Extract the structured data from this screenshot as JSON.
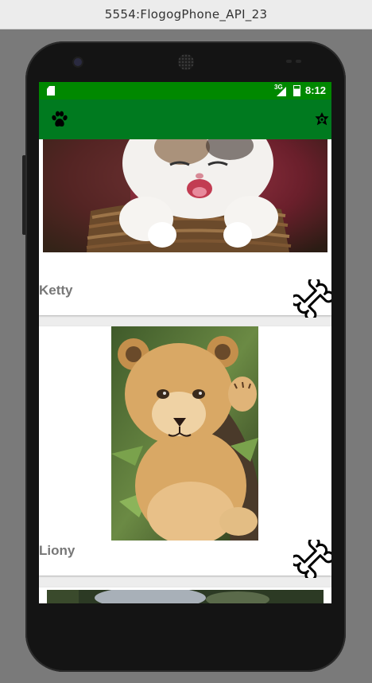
{
  "window": {
    "title": "5554:FlogogPhone_API_23"
  },
  "status_bar": {
    "network": "3G",
    "time": "8:12"
  },
  "app_bar": {
    "left_icon": "paw-icon",
    "right_icon": "star-badge-icon"
  },
  "pets": [
    {
      "name": "Ketty",
      "photo": "white-kitten-laughing-in-basket",
      "action_icon": "bone-icon"
    },
    {
      "name": "Liony",
      "photo": "lion-cub-on-branch",
      "action_icon": "bone-icon"
    },
    {
      "name": "",
      "photo": "third-pet-partially-visible",
      "action_icon": ""
    }
  ],
  "colors": {
    "status_bar": "#008800",
    "app_bar": "#007a1f",
    "card_text": "#777777"
  }
}
